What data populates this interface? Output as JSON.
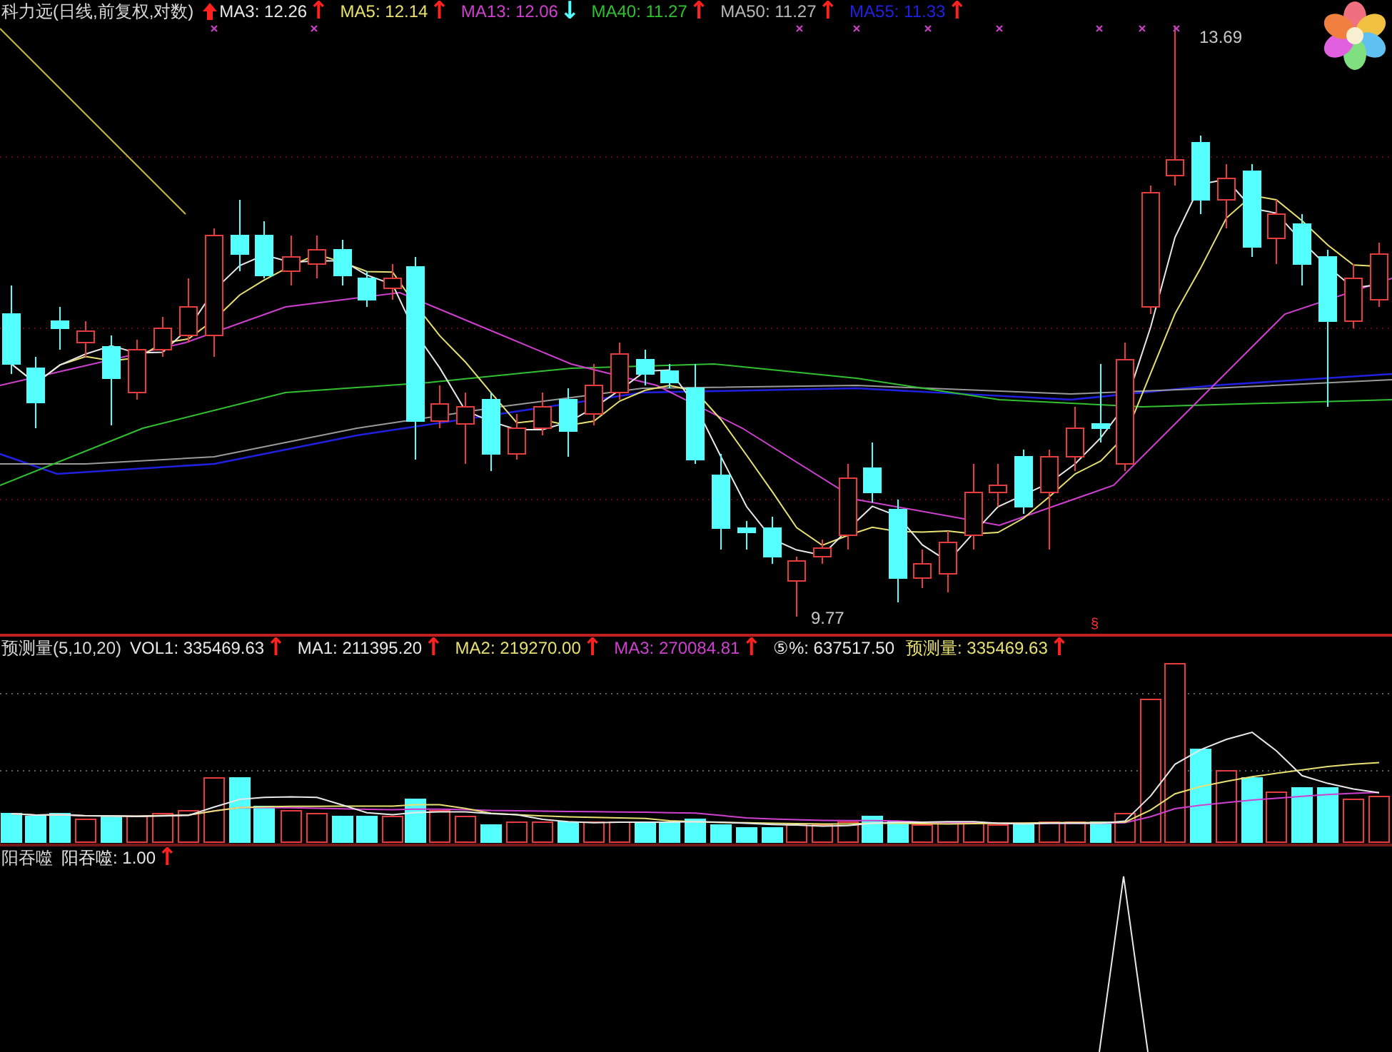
{
  "title": "科力远(日线,前复权,对数)",
  "main_indicators": [
    {
      "text": "MA3: 12.26",
      "color": "#e8e8e8",
      "arrow": {
        "symbol": "↑",
        "color": "#ff2020"
      }
    },
    {
      "text": "MA5: 12.14",
      "color": "#e8e070",
      "arrow": {
        "symbol": "↑",
        "color": "#ff2020"
      }
    },
    {
      "text": "MA13: 12.06",
      "color": "#d040d0",
      "arrow": {
        "symbol": "↓",
        "color": "#54ffff"
      }
    },
    {
      "text": "MA40: 11.27",
      "color": "#30c030",
      "arrow": {
        "symbol": "↑",
        "color": "#ff2020"
      }
    },
    {
      "text": "MA50: 11.27",
      "color": "#b8b8b8",
      "arrow": {
        "symbol": "↑",
        "color": "#ff2020"
      }
    },
    {
      "text": "MA55: 11.33",
      "color": "#2020e0",
      "arrow": {
        "symbol": "↑",
        "color": "#ff2020"
      }
    }
  ],
  "price_marks": {
    "high": "13.69",
    "low": "9.77",
    "marker": "§"
  },
  "volume_header": {
    "name": "预测量(5,10,20)",
    "indicators": [
      {
        "text": "VOL1: 335469.63",
        "color": "#e8e8e8",
        "arrow": {
          "symbol": "↑",
          "color": "#ff2020"
        }
      },
      {
        "text": "MA1: 211395.20",
        "color": "#e8e8e8",
        "arrow": {
          "symbol": "↑",
          "color": "#ff2020"
        }
      },
      {
        "text": "MA2: 219270.00",
        "color": "#e8e070",
        "arrow": {
          "symbol": "↑",
          "color": "#ff2020"
        }
      },
      {
        "text": "MA3: 270084.81",
        "color": "#d040d0",
        "arrow": {
          "symbol": "↑",
          "color": "#ff2020"
        }
      },
      {
        "text": "⑤%: 637517.50",
        "color": "#e8e8e8"
      },
      {
        "text": "预测量: 335469.63",
        "color": "#e8e070",
        "arrow": {
          "symbol": "↑",
          "color": "#ff2020"
        }
      }
    ]
  },
  "signal_header": {
    "name": "阳吞噬",
    "indicators": [
      {
        "text": "阳吞噬: 1.00",
        "color": "#e8e8e8",
        "arrow": {
          "symbol": "↑",
          "color": "#ff2020"
        }
      }
    ]
  }
}
